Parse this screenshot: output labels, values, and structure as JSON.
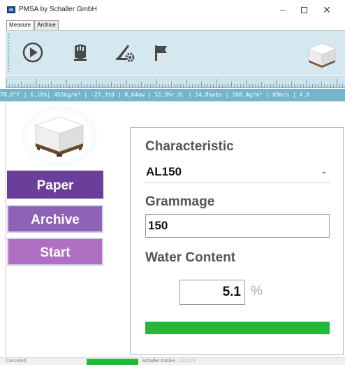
{
  "window": {
    "title": "PMSA by Schaller GmbH",
    "minimize_glyph": "–",
    "close_glyph": "✕"
  },
  "tabs": [
    {
      "label": "Measure",
      "active": true
    },
    {
      "label": "Archive",
      "active": false
    }
  ],
  "toolbar": {
    "icons": [
      "play-icon",
      "pallet-icon",
      "sensor-settings-icon",
      "flag-icon",
      "paper-stack-icon"
    ]
  },
  "readout": {
    "text": "78,0°F | 6,16%| 456kg/m³ | -27,3td | 0,64aw | 51,9%r.H. | 14,8%abs | 100,4g/m³ | 09m/s | 4,0"
  },
  "sidebar": {
    "paper_label": "Paper",
    "archive_label": "Archive",
    "start_label": "Start"
  },
  "form": {
    "characteristic_label": "Characteristic",
    "characteristic_value": "AL150",
    "grammage_label": "Grammage",
    "grammage_value": "150",
    "water_label": "Water Content",
    "water_value": "5.1",
    "water_unit": "%",
    "progress_fraction": 1.0
  },
  "status": {
    "state": "Canceled",
    "company": "Schaller GmbH",
    "version": "1.0.0.15"
  },
  "colors": {
    "accent_purple": "#6a3f99",
    "progress_green": "#22b83a",
    "toolbar_bg": "#d5e8f0",
    "readout_bg": "#74b4cd"
  }
}
